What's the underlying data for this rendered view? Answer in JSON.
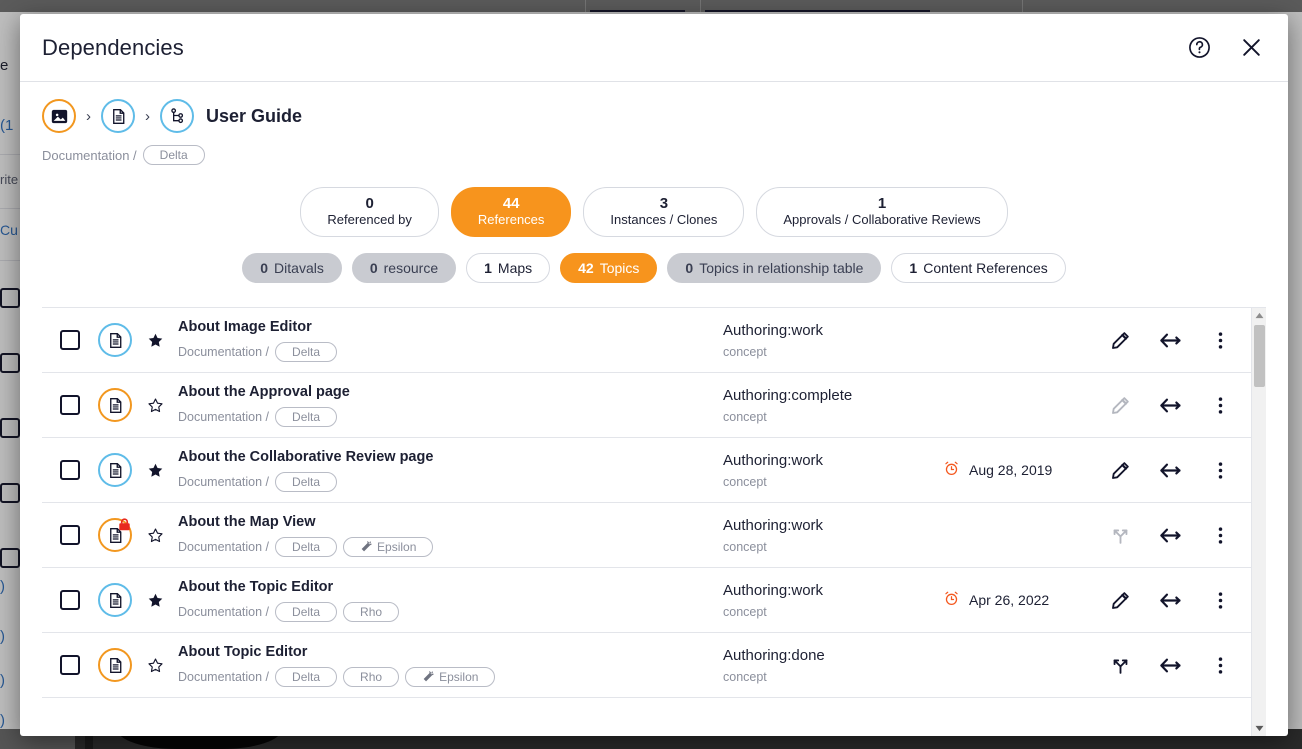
{
  "background": {
    "left_column": {
      "line1": "e",
      "line2": "(1",
      "line3": "rite",
      "line4": "Cu"
    }
  },
  "modal": {
    "title": "Dependencies",
    "help_icon": "help-circle-icon",
    "close_icon": "close-icon"
  },
  "breadcrumb": {
    "items": [
      {
        "icon": "image-icon",
        "ring": "orange"
      },
      {
        "icon": "document-icon",
        "ring": "blue"
      },
      {
        "icon": "map-tree-icon",
        "ring": "blue"
      }
    ],
    "separator": "›",
    "title": "User Guide",
    "path_label": "Documentation /",
    "tags": [
      "Delta"
    ]
  },
  "counters": [
    {
      "num": "0",
      "label": "Referenced by",
      "active": false
    },
    {
      "num": "44",
      "label": "References",
      "active": true
    },
    {
      "num": "3",
      "label": "Instances / Clones",
      "active": false
    },
    {
      "num": "1",
      "label": "Approvals / Collaborative Reviews",
      "active": false
    }
  ],
  "chips": [
    {
      "count": "0",
      "label": "Ditavals",
      "style": "grey"
    },
    {
      "count": "0",
      "label": "resource",
      "style": "grey"
    },
    {
      "count": "1",
      "label": "Maps",
      "style": "plain"
    },
    {
      "count": "42",
      "label": "Topics",
      "style": "orange"
    },
    {
      "count": "0",
      "label": "Topics in relationship table",
      "style": "grey"
    },
    {
      "count": "1",
      "label": "Content References",
      "style": "plain"
    }
  ],
  "list": {
    "path_label": "Documentation /",
    "rows": [
      {
        "title": "About Image Editor",
        "ring": "blue",
        "locked": false,
        "starred": true,
        "tags": [
          "Delta"
        ],
        "status": "Authoring:work",
        "type": "concept",
        "date": "",
        "edit_icon": "pencil-icon",
        "edit_state": "enabled"
      },
      {
        "title": "About the Approval page",
        "ring": "orange",
        "locked": false,
        "starred": false,
        "tags": [
          "Delta"
        ],
        "status": "Authoring:complete",
        "type": "concept",
        "date": "",
        "edit_icon": "pencil-icon",
        "edit_state": "disabled"
      },
      {
        "title": "About the Collaborative Review page",
        "ring": "blue",
        "locked": false,
        "starred": true,
        "tags": [
          "Delta"
        ],
        "status": "Authoring:work",
        "type": "concept",
        "date": "Aug 28, 2019",
        "edit_icon": "pencil-icon",
        "edit_state": "enabled"
      },
      {
        "title": "About the Map View",
        "ring": "orange",
        "locked": true,
        "starred": false,
        "tags": [
          "Delta",
          "Epsilon"
        ],
        "status": "Authoring:work",
        "type": "concept",
        "date": "",
        "edit_icon": "branch-icon",
        "edit_state": "disabled"
      },
      {
        "title": "About the Topic Editor",
        "ring": "blue",
        "locked": false,
        "starred": true,
        "tags": [
          "Delta",
          "Rho"
        ],
        "status": "Authoring:work",
        "type": "concept",
        "date": "Apr 26, 2022",
        "edit_icon": "pencil-icon",
        "edit_state": "enabled"
      },
      {
        "title": "About Topic Editor",
        "ring": "orange",
        "locked": false,
        "starred": false,
        "tags": [
          "Delta",
          "Rho",
          "Epsilon"
        ],
        "status": "Authoring:done",
        "type": "concept",
        "date": "",
        "edit_icon": "branch-icon",
        "edit_state": "enabled"
      }
    ],
    "row_actions": {
      "where_used_icon": "where-used-arrow-icon",
      "more_icon": "more-vertical-icon"
    }
  },
  "colors": {
    "accent_orange": "#f7941d",
    "ring_blue": "#5fbce8",
    "ring_orange": "#f2971f",
    "text_dark": "#1d2033",
    "text_muted": "#8b8f9c",
    "alarm_red": "#f4581f",
    "lock_red": "#e8291d"
  }
}
